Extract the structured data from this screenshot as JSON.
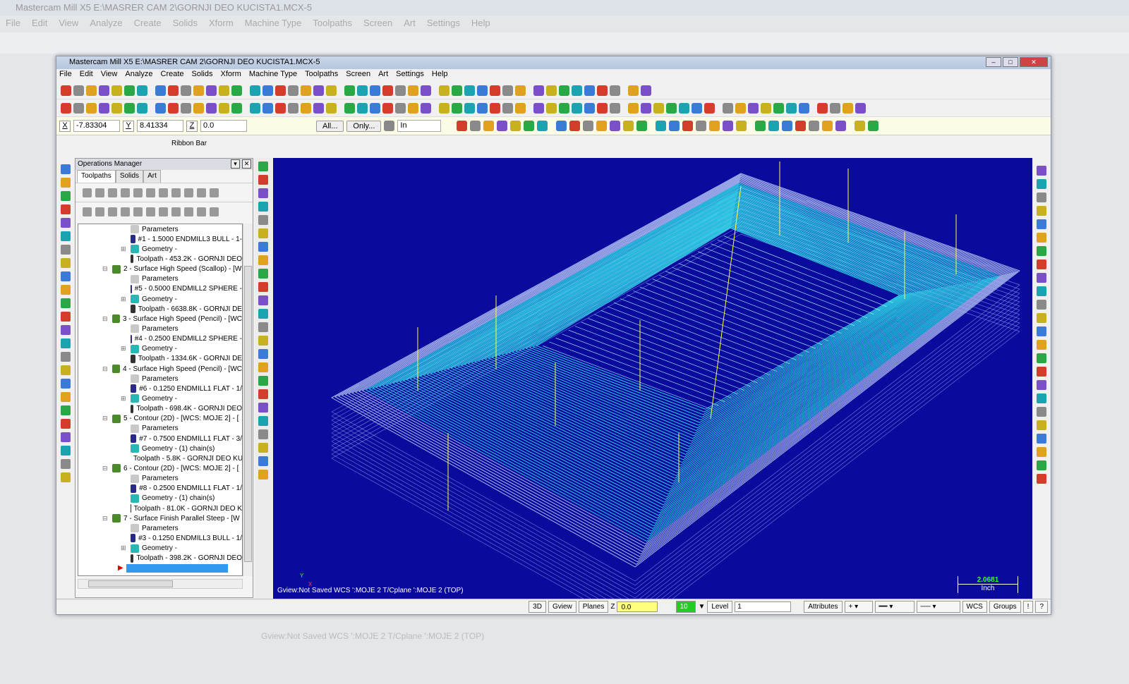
{
  "background_window": {
    "title": "Mastercam Mill X5  E:\\MASRER CAM 2\\GORNJI DEO KUCISTA1.MCX-5",
    "menu": [
      "File",
      "Edit",
      "View",
      "Analyze",
      "Create",
      "Solids",
      "Xform",
      "Machine Type",
      "Toolpaths",
      "Screen",
      "Art",
      "Settings",
      "Help"
    ],
    "status": "Gview:Not Saved   WCS ':MOJE 2   T/Cplane ':MOJE 2 (TOP)"
  },
  "window": {
    "title": "Mastercam Mill X5  E:\\MASRER CAM 2\\GORNJI DEO KUCISTA1.MCX-5",
    "controls": [
      "–",
      "□",
      "✕"
    ]
  },
  "menu": [
    "File",
    "Edit",
    "View",
    "Analyze",
    "Create",
    "Solids",
    "Xform",
    "Machine Type",
    "Toolpaths",
    "Screen",
    "Art",
    "Settings",
    "Help"
  ],
  "coords": {
    "x_label": "X",
    "x": "-7.83304",
    "y_label": "Y",
    "y": "8.41334",
    "z_label": "Z",
    "z": "0.0",
    "all_button": "All...",
    "only_button": "Only...",
    "mode": "In"
  },
  "ribbon_label": "Ribbon Bar",
  "ops_manager": {
    "title": "Operations Manager",
    "tabs": [
      "Toolpaths",
      "Solids",
      "Art"
    ],
    "active_tab": "Toolpaths",
    "tree": [
      {
        "level": 2,
        "icon": "folder",
        "text": "Parameters"
      },
      {
        "level": 2,
        "icon": "tool",
        "text": "#1 - 1.5000 ENDMILL3 BULL -  1-"
      },
      {
        "level": 2,
        "icon": "geometry",
        "expand": true,
        "text": "Geometry -"
      },
      {
        "level": 2,
        "icon": "toolpath",
        "text": "Toolpath - 453.2K - GORNJI DEO"
      },
      {
        "level": 1,
        "icon": "op",
        "expand": true,
        "text": "2 - Surface High Speed (Scallop) - [W"
      },
      {
        "level": 2,
        "icon": "folder",
        "text": "Parameters"
      },
      {
        "level": 2,
        "icon": "tool",
        "text": "#5 - 0.5000 ENDMILL2 SPHERE -"
      },
      {
        "level": 2,
        "icon": "geometry",
        "expand": true,
        "text": "Geometry -"
      },
      {
        "level": 2,
        "icon": "toolpath",
        "text": "Toolpath - 6638.8K - GORNJI DE"
      },
      {
        "level": 1,
        "icon": "op",
        "expand": true,
        "text": "3 - Surface High Speed (Pencil) - [WC"
      },
      {
        "level": 2,
        "icon": "folder",
        "text": "Parameters"
      },
      {
        "level": 2,
        "icon": "tool",
        "text": "#4 - 0.2500 ENDMILL2 SPHERE -"
      },
      {
        "level": 2,
        "icon": "geometry",
        "expand": true,
        "text": "Geometry -"
      },
      {
        "level": 2,
        "icon": "toolpath",
        "text": "Toolpath - 1334.6K - GORNJI DE"
      },
      {
        "level": 1,
        "icon": "op",
        "expand": true,
        "text": "4 - Surface High Speed (Pencil) - [WC"
      },
      {
        "level": 2,
        "icon": "folder",
        "text": "Parameters"
      },
      {
        "level": 2,
        "icon": "tool",
        "text": "#6 - 0.1250 ENDMILL1 FLAT -  1/"
      },
      {
        "level": 2,
        "icon": "geometry",
        "expand": true,
        "text": "Geometry -"
      },
      {
        "level": 2,
        "icon": "toolpath",
        "text": "Toolpath - 698.4K - GORNJI DEO"
      },
      {
        "level": 1,
        "icon": "op",
        "expand": true,
        "text": "5 - Contour (2D) - [WCS: MOJE 2] - ["
      },
      {
        "level": 2,
        "icon": "folder",
        "text": "Parameters"
      },
      {
        "level": 2,
        "icon": "tool",
        "text": "#7 - 0.7500 ENDMILL1 FLAT -  3/"
      },
      {
        "level": 2,
        "icon": "geometry",
        "text": "Geometry - (1) chain(s)"
      },
      {
        "level": 2,
        "icon": "toolpath",
        "text": "Toolpath - 5.8K - GORNJI DEO KU"
      },
      {
        "level": 1,
        "icon": "op",
        "expand": true,
        "text": "6 - Contour (2D) - [WCS: MOJE 2] - ["
      },
      {
        "level": 2,
        "icon": "folder",
        "text": "Parameters"
      },
      {
        "level": 2,
        "icon": "tool",
        "text": "#8 - 0.2500 ENDMILL1 FLAT -  1/"
      },
      {
        "level": 2,
        "icon": "geometry",
        "text": "Geometry - (1) chain(s)"
      },
      {
        "level": 2,
        "icon": "toolpath",
        "text": "Toolpath - 81.0K - GORNJI DEO K"
      },
      {
        "level": 1,
        "icon": "op",
        "expand": true,
        "text": "7 - Surface Finish Parallel Steep - [W"
      },
      {
        "level": 2,
        "icon": "folder",
        "text": "Parameters"
      },
      {
        "level": 2,
        "icon": "tool",
        "text": "#3 - 0.1250 ENDMILL3 BULL -  1/"
      },
      {
        "level": 2,
        "icon": "geometry",
        "expand": true,
        "text": "Geometry -"
      },
      {
        "level": 2,
        "icon": "toolpath",
        "text": "Toolpath - 398.2K - GORNJI DEO"
      },
      {
        "level": 1,
        "icon": "insert-arrow",
        "text": ""
      }
    ]
  },
  "viewport": {
    "info": "Gview:Not Saved   WCS ':MOJE 2   T/Cplane ':MOJE 2 (TOP)",
    "scale_value": "2.0681",
    "scale_unit": "Inch",
    "axis_labels": [
      "Y",
      "X"
    ],
    "colors": {
      "background": "#0a0a9c",
      "toolpath": "#33f0f0",
      "rapid": "#ffff40"
    }
  },
  "status": {
    "view3d": "3D",
    "gview": "Gview",
    "planes": "Planes",
    "z_label": "Z",
    "z_value": "0.0",
    "color_value": "10",
    "level_label": "Level",
    "level_value": "1",
    "attributes": "Attributes",
    "wcs": "WCS",
    "groups": "Groups",
    "bang": "!",
    "help": "?"
  }
}
